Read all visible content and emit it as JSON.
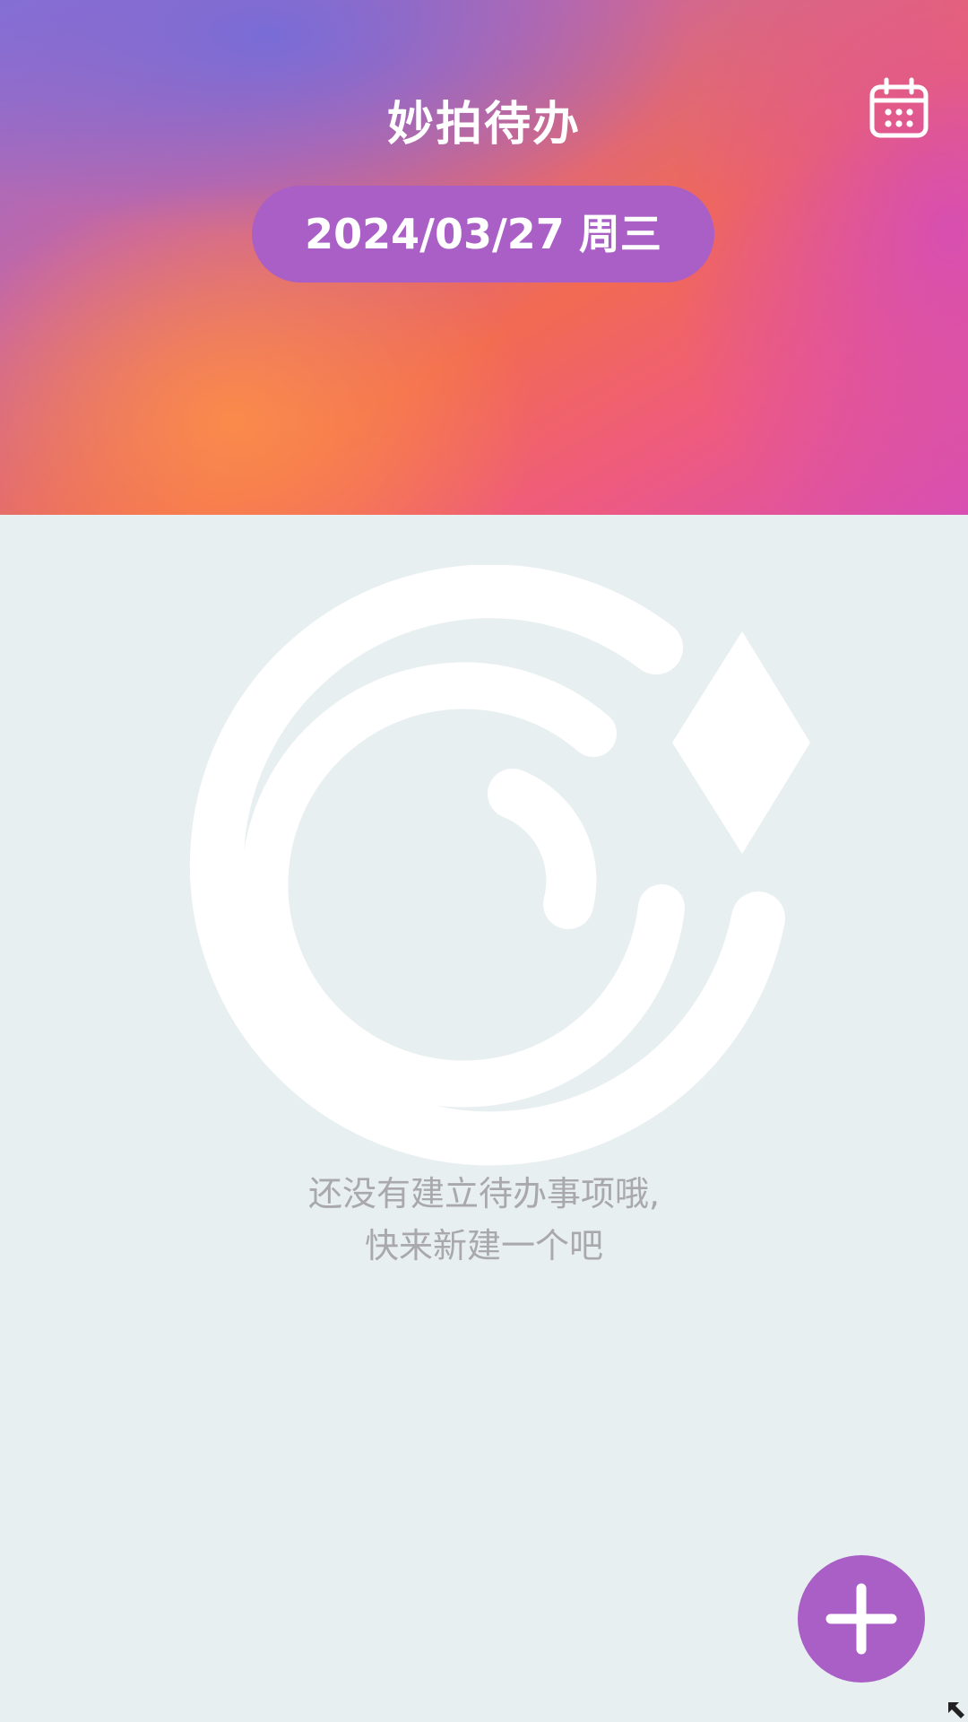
{
  "header": {
    "title": "妙拍待办",
    "date_label": "2024/03/27 周三",
    "calendar_icon": "calendar-icon",
    "gradient_colors": [
      "#8a6fd4",
      "#c866a2",
      "#f26a52",
      "#fb8c4a",
      "#d84fb1"
    ]
  },
  "empty_state": {
    "illustration_icon": "empty-camera-icon",
    "message_line1": "还没有建立待办事项哦,",
    "message_line2": "快来新建一个吧"
  },
  "fab": {
    "icon": "plus-icon",
    "color": "#a95fc6"
  },
  "colors": {
    "background": "#e8eff0",
    "accent": "#a95fc6",
    "empty_text": "#a8a8ad"
  }
}
